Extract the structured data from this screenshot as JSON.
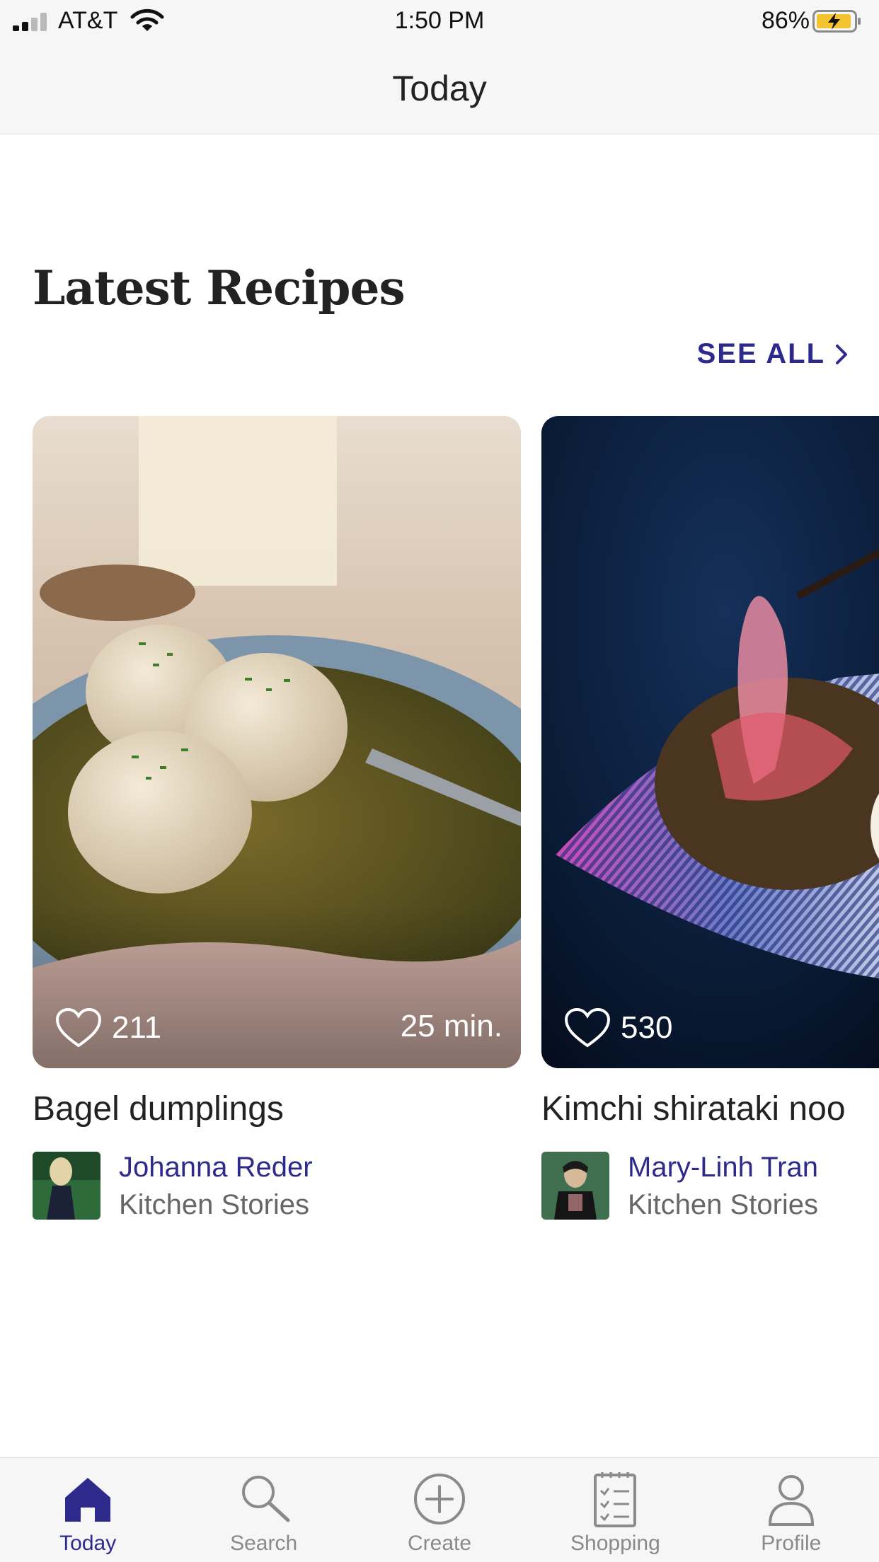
{
  "status_bar": {
    "carrier": "AT&T",
    "time": "1:50 PM",
    "battery": "86%"
  },
  "header": {
    "title": "Today"
  },
  "section": {
    "title": "Latest Recipes",
    "see_all": "SEE ALL"
  },
  "recipes": [
    {
      "likes": "211",
      "duration": "25 min.",
      "title": "Bagel dumplings",
      "author": "Johanna Reder",
      "source": "Kitchen Stories"
    },
    {
      "likes": "530",
      "title": "Kimchi shirataki noo",
      "author": "Mary-Linh Tran",
      "source": "Kitchen Stories"
    }
  ],
  "tabs": [
    {
      "label": "Today",
      "icon": "home-icon",
      "active": true
    },
    {
      "label": "Search",
      "icon": "search-icon",
      "active": false
    },
    {
      "label": "Create",
      "icon": "plus-circle-icon",
      "active": false
    },
    {
      "label": "Shopping",
      "icon": "checklist-icon",
      "active": false
    },
    {
      "label": "Profile",
      "icon": "person-icon",
      "active": false
    }
  ],
  "colors": {
    "accent": "#2d2a8c",
    "inactive": "#8a8a8a",
    "battery_charge": "#f4c430"
  }
}
